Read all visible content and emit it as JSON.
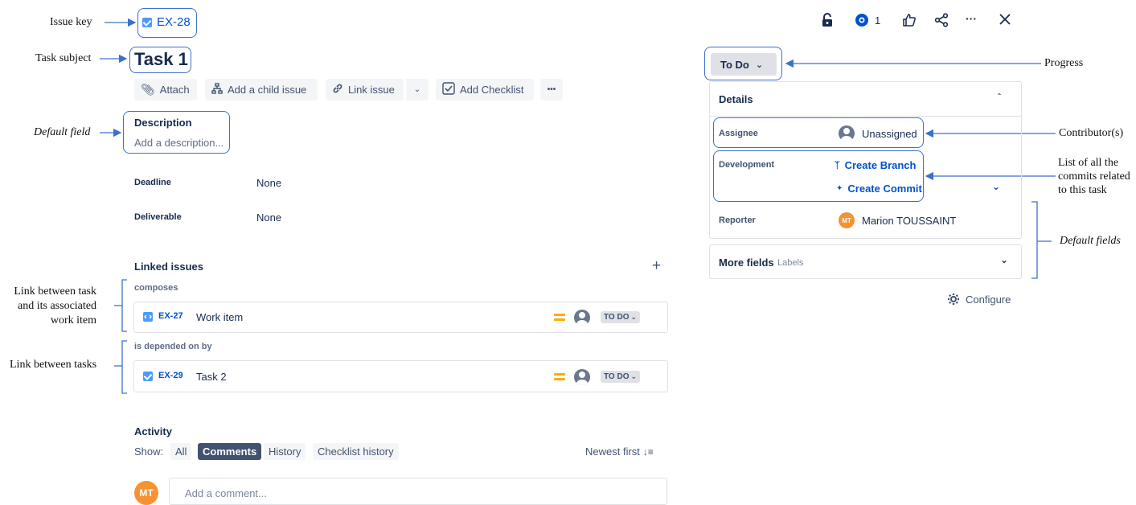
{
  "issue": {
    "key": "EX-28",
    "title": "Task 1"
  },
  "toolbar": {
    "attach": "Attach",
    "add_child": "Add a child issue",
    "link_issue": "Link issue",
    "add_checklist": "Add Checklist",
    "more": "•••"
  },
  "description": {
    "label": "Description",
    "placeholder": "Add a description..."
  },
  "fields": [
    {
      "label": "Deadline",
      "value": "None"
    },
    {
      "label": "Deliverable",
      "value": "None"
    }
  ],
  "linked": {
    "title": "Linked issues",
    "add": "+",
    "groups": [
      {
        "relation": "composes",
        "key": "EX-27",
        "summary": "Work item",
        "status": "TO DO",
        "type_icon": "subtask-icon"
      },
      {
        "relation": "is depended on by",
        "key": "EX-29",
        "summary": "Task 2",
        "status": "TO DO",
        "type_icon": "task-checkbox-icon"
      }
    ]
  },
  "activity": {
    "title": "Activity",
    "show_label": "Show:",
    "tabs": [
      "All",
      "Comments",
      "History",
      "Checklist history"
    ],
    "active_tab": "Comments",
    "sort": "Newest first",
    "avatar": "MT",
    "comment_placeholder": "Add a comment..."
  },
  "topbar": {
    "watch_count": "1",
    "icons": [
      "lock-icon",
      "eye-icon",
      "thumbs-up-icon",
      "share-icon",
      "more-icon",
      "close-icon"
    ]
  },
  "status": {
    "label": "To Do"
  },
  "details": {
    "title": "Details",
    "assignee_label": "Assignee",
    "assignee_value": "Unassigned",
    "development_label": "Development",
    "create_branch": "Create Branch",
    "create_commit": "Create Commit",
    "reporter_label": "Reporter",
    "reporter_initials": "MT",
    "reporter_value": "Marion TOUSSAINT",
    "more_fields": "More fields",
    "more_fields_hint": "Labels",
    "configure": "Configure"
  },
  "annotations": {
    "issue_key": "Issue key",
    "task_subject": "Task subject",
    "default_field": "Default field",
    "link_task_work": [
      "Link between task",
      "and its associated",
      "work item"
    ],
    "link_tasks": "Link between tasks",
    "progress": "Progress",
    "contributors": "Contributor(s)",
    "commits": [
      "List of all the",
      "commits related",
      "to this task"
    ],
    "default_fields": "Default fields"
  },
  "colors": {
    "annotation_blue": "#3d6fd1",
    "link_blue": "#0052cc",
    "priority_orange": "#ffab00",
    "avatar_orange": "#f79232"
  }
}
